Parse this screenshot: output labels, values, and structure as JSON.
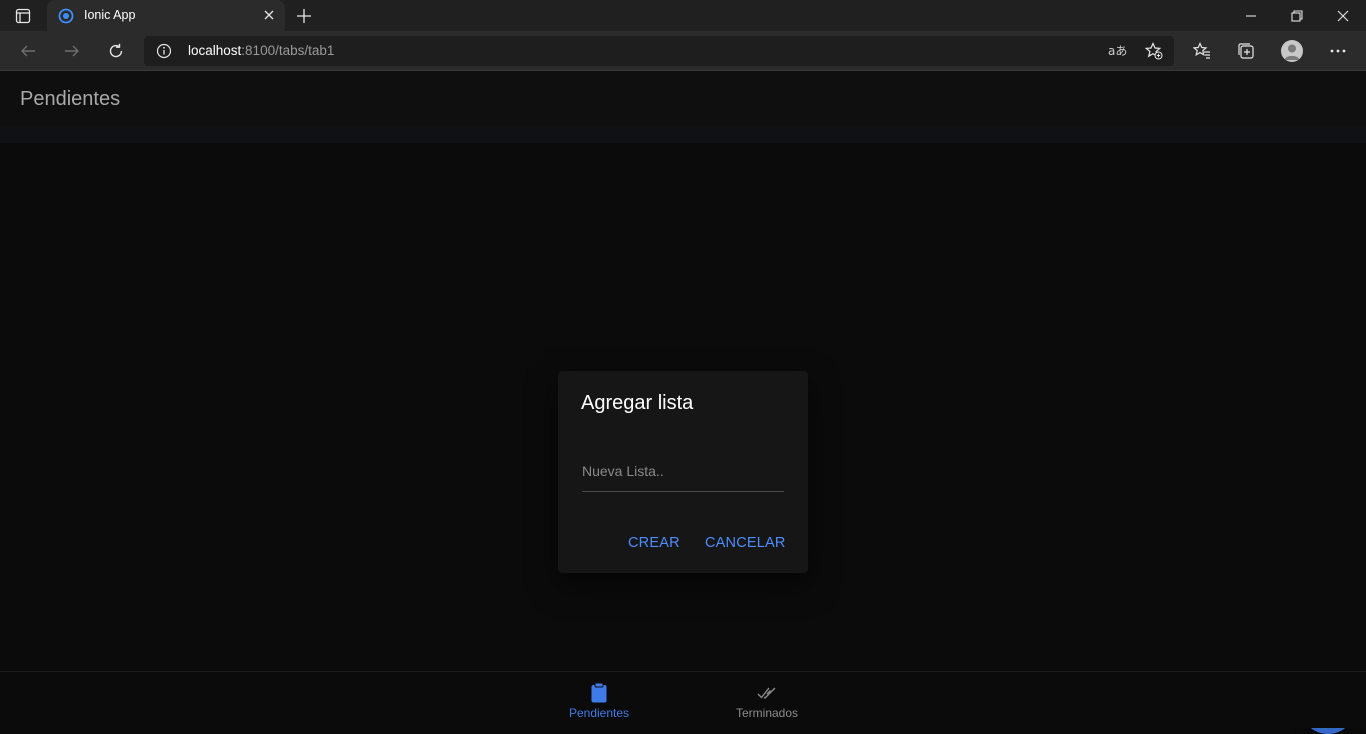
{
  "browser": {
    "tab_title": "Ionic App",
    "url_host": "localhost",
    "url_rest": ":8100/tabs/tab1"
  },
  "header": {
    "title": "Pendientes"
  },
  "alert": {
    "title": "Agregar lista",
    "input_placeholder": "Nueva Lista..",
    "buttons": {
      "create": "CREAR",
      "cancel": "CANCELAR"
    }
  },
  "tabs": [
    {
      "label": "Pendientes",
      "icon": "clipboard-icon",
      "active": true
    },
    {
      "label": "Terminados",
      "icon": "done-all-icon",
      "active": false
    }
  ],
  "colors": {
    "accent": "#4d8dff",
    "fab": "#3468c8",
    "active_tab": "#3f7be8",
    "inactive_tab": "#8c8c8c"
  }
}
